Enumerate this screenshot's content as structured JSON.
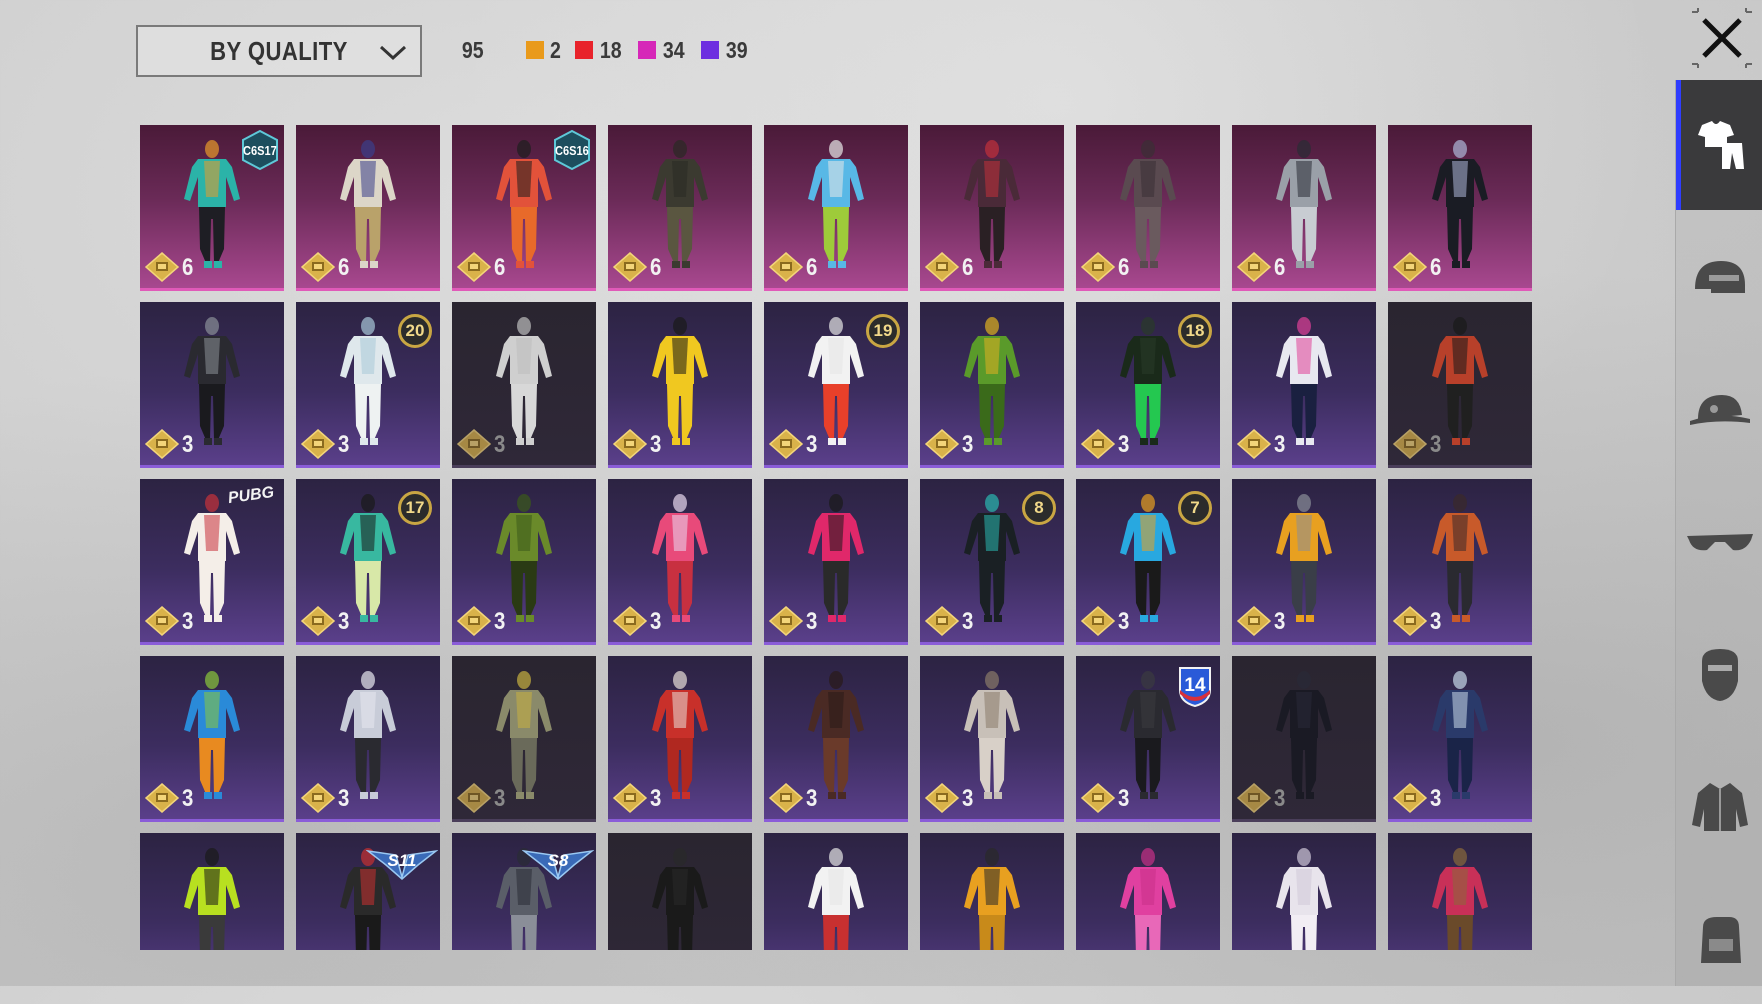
{
  "sort": {
    "label": "BY QUALITY"
  },
  "counts": {
    "total": "95",
    "items": [
      {
        "value": "2",
        "color": "#e99a1b"
      },
      {
        "value": "18",
        "color": "#e8232b"
      },
      {
        "value": "34",
        "color": "#d627b8"
      },
      {
        "value": "39",
        "color": "#6d2fe0"
      }
    ]
  },
  "sidebar": {
    "tabs": [
      {
        "name": "outfit-tab",
        "icon": "shirt-pants-icon",
        "active": true
      },
      {
        "name": "helmet-tab",
        "icon": "helmet-icon"
      },
      {
        "name": "hat-tab",
        "icon": "cap-icon"
      },
      {
        "name": "glasses-tab",
        "icon": "glasses-icon"
      },
      {
        "name": "mask-tab",
        "icon": "mask-icon"
      },
      {
        "name": "jacket-tab",
        "icon": "jacket-icon"
      },
      {
        "name": "backpack-tab",
        "icon": "backpack-icon"
      }
    ]
  },
  "colors": {
    "pink_quality": "#e05ab8",
    "purple_quality": "#8a5cd8"
  },
  "cards": [
    {
      "quality": "pink",
      "level": "6",
      "tag": "C6S17",
      "tagType": "hex",
      "c": [
        "#2bb3a8",
        "#e89a2a",
        "#1e1e24"
      ]
    },
    {
      "quality": "pink",
      "level": "6",
      "c": [
        "#dcd6c8",
        "#3a3f8a",
        "#b9a26a"
      ]
    },
    {
      "quality": "pink",
      "level": "6",
      "tag": "C6S16",
      "tagType": "hex",
      "c": [
        "#e2523a",
        "#1e1e1e",
        "#e86a2a"
      ]
    },
    {
      "quality": "pink",
      "level": "6",
      "c": [
        "#3b3a30",
        "#2a2a24",
        "#5a5640"
      ]
    },
    {
      "quality": "pink",
      "level": "6",
      "c": [
        "#58b8e6",
        "#e8e8e8",
        "#9ecb3a"
      ]
    },
    {
      "quality": "pink",
      "level": "6",
      "c": [
        "#4a2a38",
        "#c2303a",
        "#2a2024"
      ]
    },
    {
      "quality": "pink",
      "level": "6",
      "c": [
        "#5a4a50",
        "#3a2f34",
        "#6a5a5e"
      ]
    },
    {
      "quality": "pink",
      "level": "6",
      "c": [
        "#9aa0a8",
        "#2a2c34",
        "#c8ccd2"
      ]
    },
    {
      "quality": "pink",
      "level": "6",
      "c": [
        "#1a1c24",
        "#aeb8d8",
        "#1a1c24"
      ]
    },
    {
      "quality": "purple",
      "level": "3",
      "c": [
        "#2a2a30",
        "#8a9098",
        "#1a1a1e"
      ]
    },
    {
      "quality": "purple",
      "level": "3",
      "tag": "20",
      "tagType": "circle",
      "c": [
        "#dfe8ec",
        "#a8c8d8",
        "#eef2f2"
      ]
    },
    {
      "quality": "dark",
      "level": "3",
      "c": [
        "#cfcfcf",
        "#bdbdbd",
        "#d8d8d8"
      ]
    },
    {
      "quality": "purple",
      "level": "3",
      "c": [
        "#f0c820",
        "#1a1a1a",
        "#f0c820"
      ]
    },
    {
      "quality": "purple",
      "level": "3",
      "tag": "19",
      "tagType": "circle",
      "c": [
        "#f2f2f2",
        "#e6e6e6",
        "#e8402a"
      ]
    },
    {
      "quality": "purple",
      "level": "3",
      "c": [
        "#5a9a2a",
        "#e0b020",
        "#3a6a1a"
      ]
    },
    {
      "quality": "purple",
      "level": "3",
      "tag": "18",
      "tagType": "circle",
      "c": [
        "#1a2a1a",
        "#2a3a2a",
        "#24c850"
      ]
    },
    {
      "quality": "purple",
      "level": "3",
      "c": [
        "#e8e8f0",
        "#e04098",
        "#1a2040"
      ]
    },
    {
      "quality": "dark",
      "level": "3",
      "c": [
        "#b8402a",
        "#1a1a1a",
        "#202020"
      ]
    },
    {
      "quality": "purple",
      "level": "3",
      "tag": "PUBG",
      "tagType": "text",
      "c": [
        "#f4eee8",
        "#c8323a",
        "#f4eee8"
      ]
    },
    {
      "quality": "purple",
      "level": "3",
      "tag": "17",
      "tagType": "circle",
      "c": [
        "#38b8a0",
        "#1a1a1a",
        "#d8e8a8"
      ]
    },
    {
      "quality": "purple",
      "level": "3",
      "c": [
        "#6a8a2a",
        "#3a5a1a",
        "#2a3a14"
      ]
    },
    {
      "quality": "purple",
      "level": "3",
      "c": [
        "#e84a7a",
        "#e8d8f0",
        "#c83040"
      ]
    },
    {
      "quality": "purple",
      "level": "3",
      "c": [
        "#e0286a",
        "#1a1a1a",
        "#2a2a2a"
      ]
    },
    {
      "quality": "purple",
      "level": "3",
      "tag": "8",
      "tagType": "circle",
      "c": [
        "#1a2024",
        "#2ab8b0",
        "#1a2024"
      ]
    },
    {
      "quality": "purple",
      "level": "3",
      "tag": "7",
      "tagType": "circle",
      "c": [
        "#28a8e0",
        "#e8a020",
        "#1a1a1a"
      ]
    },
    {
      "quality": "purple",
      "level": "3",
      "c": [
        "#e8a020",
        "#8a8e98",
        "#3a3e48"
      ]
    },
    {
      "quality": "purple",
      "level": "3",
      "c": [
        "#c85a2a",
        "#3a2a2a",
        "#2a2a30"
      ]
    },
    {
      "quality": "purple",
      "level": "3",
      "c": [
        "#2a8ad8",
        "#8ac83a",
        "#e88a20"
      ]
    },
    {
      "quality": "purple",
      "level": "3",
      "c": [
        "#c8ccd8",
        "#e8e8f0",
        "#2a2a30"
      ]
    },
    {
      "quality": "dark",
      "level": "3",
      "c": [
        "#8a8a6a",
        "#c8b040",
        "#6a6a5a"
      ]
    },
    {
      "quality": "purple",
      "level": "3",
      "c": [
        "#c8302a",
        "#e8e0d8",
        "#b02820"
      ]
    },
    {
      "quality": "purple",
      "level": "3",
      "c": [
        "#4a2a24",
        "#2a1a18",
        "#6a3a2a"
      ]
    },
    {
      "quality": "purple",
      "level": "3",
      "c": [
        "#c8c0b8",
        "#8a7a6a",
        "#d8d0c8"
      ]
    },
    {
      "quality": "purple",
      "level": "3",
      "tag": "14",
      "tagType": "shield",
      "c": [
        "#2a2a30",
        "#3a3a40",
        "#1a1a1e"
      ]
    },
    {
      "quality": "dark",
      "level": "3",
      "c": [
        "#1a1a24",
        "#2a2a38",
        "#1a1a24"
      ]
    },
    {
      "quality": "purple",
      "level": "3",
      "c": [
        "#2a3a6a",
        "#c8d8e8",
        "#1a2448"
      ]
    },
    {
      "quality": "purple",
      "level": "",
      "c": [
        "#b8e020",
        "#1a1a1a",
        "#3a3a3a"
      ]
    },
    {
      "quality": "purple",
      "level": "",
      "tag": "S11",
      "tagType": "wings",
      "c": [
        "#2a2a2a",
        "#c83030",
        "#1a1a1a"
      ]
    },
    {
      "quality": "purple",
      "level": "",
      "tag": "S8",
      "tagType": "wings",
      "c": [
        "#5a5e68",
        "#2a2c34",
        "#8a8e98"
      ]
    },
    {
      "quality": "dark",
      "level": "",
      "c": [
        "#1a1a1a",
        "#2a2a2a",
        "#1a1a1a"
      ]
    },
    {
      "quality": "purple",
      "level": "",
      "c": [
        "#f2f2f2",
        "#e6e6e6",
        "#c83030"
      ]
    },
    {
      "quality": "purple",
      "level": "",
      "c": [
        "#e8a020",
        "#2a2a2a",
        "#c88a1a"
      ]
    },
    {
      "quality": "purple",
      "level": "",
      "c": [
        "#e040a0",
        "#c83088",
        "#e868b8"
      ]
    },
    {
      "quality": "purple",
      "level": "",
      "c": [
        "#e8e4ec",
        "#cfc8d8",
        "#f2eef4"
      ]
    },
    {
      "quality": "purple",
      "level": "",
      "c": [
        "#c83058",
        "#8a6a3a",
        "#6a4a2a"
      ]
    }
  ]
}
